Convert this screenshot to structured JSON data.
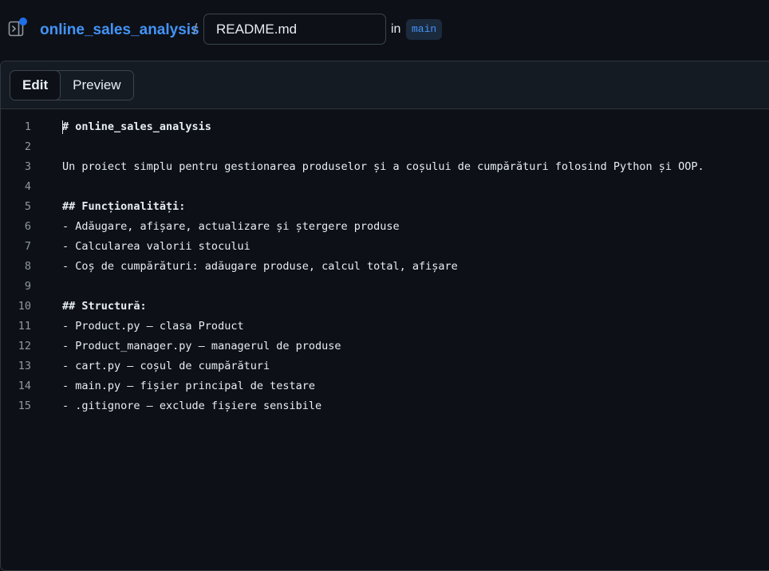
{
  "header": {
    "panel_icon": "sidebar-expand-icon",
    "repo_name": "online_sales_analysis",
    "separator": "/",
    "filename": "README.md",
    "in_label": "in",
    "branch": "main"
  },
  "editor": {
    "tabs": [
      {
        "label": "Edit",
        "active": true
      },
      {
        "label": "Preview",
        "active": false
      }
    ],
    "lines": [
      {
        "num": "1",
        "text": "# online_sales_analysis",
        "bold": true
      },
      {
        "num": "2",
        "text": "",
        "bold": false
      },
      {
        "num": "3",
        "text": "Un proiect simplu pentru gestionarea produselor și a coșului de cumpărături folosind Python și OOP.",
        "bold": false
      },
      {
        "num": "4",
        "text": "",
        "bold": false
      },
      {
        "num": "5",
        "text": "## Funcționalități:",
        "bold": true
      },
      {
        "num": "6",
        "text": "- Adăugare, afișare, actualizare și ștergere produse",
        "bold": false
      },
      {
        "num": "7",
        "text": "- Calcularea valorii stocului",
        "bold": false
      },
      {
        "num": "8",
        "text": "- Coș de cumpărături: adăugare produse, calcul total, afișare",
        "bold": false
      },
      {
        "num": "9",
        "text": "",
        "bold": false
      },
      {
        "num": "10",
        "text": "## Structură:",
        "bold": true
      },
      {
        "num": "11",
        "text": "- Product.py – clasa Product",
        "bold": false
      },
      {
        "num": "12",
        "text": "- Product_manager.py – managerul de produse",
        "bold": false
      },
      {
        "num": "13",
        "text": "- cart.py – coșul de cumpărături",
        "bold": false
      },
      {
        "num": "14",
        "text": "- main.py – fișier principal de testare",
        "bold": false
      },
      {
        "num": "15",
        "text": "- .gitignore – exclude fișiere sensibile",
        "bold": false
      }
    ]
  },
  "colors": {
    "accent": "#4493f8",
    "background": "#0d1117",
    "notification_dot": "#1f6feb"
  }
}
